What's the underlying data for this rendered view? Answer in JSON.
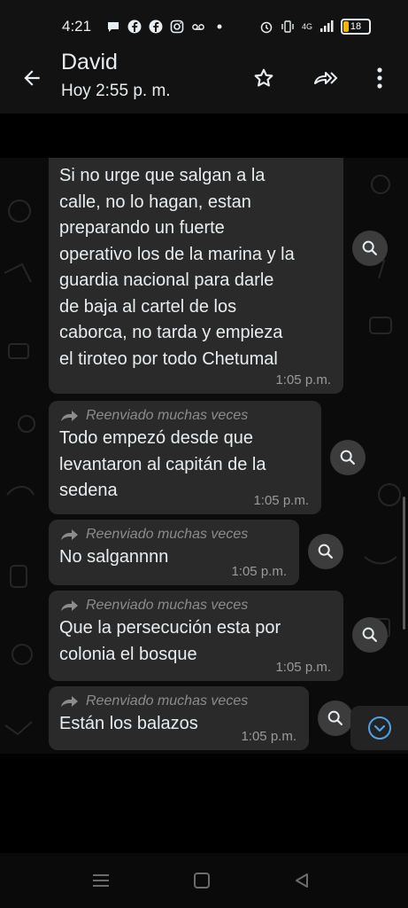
{
  "status_bar": {
    "time": "4:21",
    "left_icons": [
      "chat-bubble-icon",
      "facebook-icon",
      "facebook-icon",
      "instagram-icon",
      "voicemail-icon",
      "dot-icon"
    ],
    "network": "4G",
    "battery": "18"
  },
  "header": {
    "contact_name": "David",
    "last_seen": "Hoy 2:55 p. m."
  },
  "messages": [
    {
      "forwarded_label": "",
      "text": "Si no urge que salgan a la\ncalle, no lo hagan, estan\npreparando un fuerte\noperativo los de la marina y la\nguardia nacional para darle\nde baja al cartel de los\ncaborca, no tarda y empieza\nel tiroteo por todo Chetumal",
      "time": "1:05 p.m."
    },
    {
      "forwarded_label": "Reenviado muchas veces",
      "text": "Todo empezó desde que\nlevantaron al capitán de la\nsedena",
      "time": "1:05 p.m."
    },
    {
      "forwarded_label": "Reenviado muchas veces",
      "text": "No salgannnn",
      "time": "1:05 p.m."
    },
    {
      "forwarded_label": "Reenviado muchas veces",
      "text": "Que la persecución esta por\ncolonia el bosque",
      "time": "1:05 p.m."
    },
    {
      "forwarded_label": "Reenviado muchas veces",
      "text": "Están los balazos",
      "time": "1:05 p.m."
    }
  ],
  "colors": {
    "bubble": "#2a2a2a",
    "background": "#000000",
    "accent": "#4fa3e0"
  }
}
